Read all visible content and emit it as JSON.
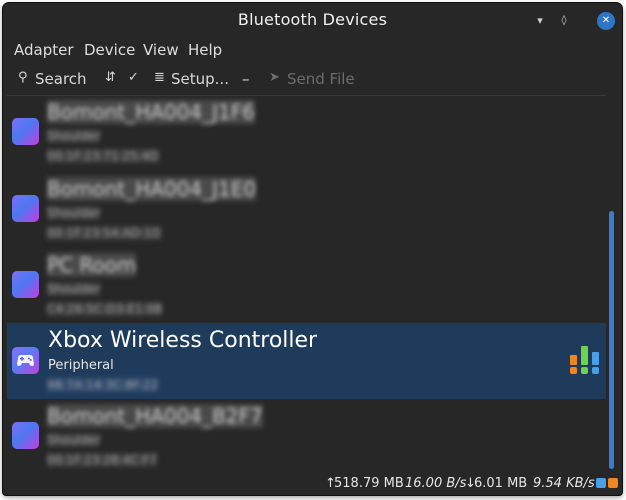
{
  "window": {
    "title": "Bluetooth Devices"
  },
  "window_controls": {
    "minimize": "▾",
    "maximize": "◊",
    "close": "✕"
  },
  "menu": [
    "Adapter",
    "Device",
    "View",
    "Help"
  ],
  "toolbar": {
    "search_label": "Search",
    "setup_label": "Setup...",
    "send_file_label": "Send File",
    "remove_label": "–"
  },
  "devices": [
    {
      "name": "Bomont_HA004_J1F6",
      "type": "Shoulder",
      "address": "00:1F:23:71:25:4D"
    },
    {
      "name": "Bomont_HA004_J1E0",
      "type": "Shoulder",
      "address": "00:1F:23:54:AD:1D"
    },
    {
      "name": "PC Room",
      "type": "Shoulder",
      "address": "C4:26:5C:D3:E1:0B"
    },
    {
      "name": "Xbox Wireless Controller",
      "type": "Peripheral",
      "address": "98:7A:14:3C:8F:22",
      "selected": true
    },
    {
      "name": "Bomont_HA004_B2F7",
      "type": "Shoulder",
      "address": "00:1F:23:28:4C:F7"
    }
  ],
  "status": {
    "upload_arrow": "↑",
    "uploaded": "518.79 MB",
    "upload_rate": "16.00 B/s",
    "download_arrow": "↓",
    "downloaded": "6.01 MB",
    "download_rate": "9.54 KB/s"
  },
  "colors": {
    "selection": "#1f3b5c",
    "accent": "#3c7cd0",
    "close_button": "#2f74c7",
    "signal_green": "#6ad44a",
    "signal_orange": "#f0861e",
    "signal_blue": "#4aa0e8"
  }
}
